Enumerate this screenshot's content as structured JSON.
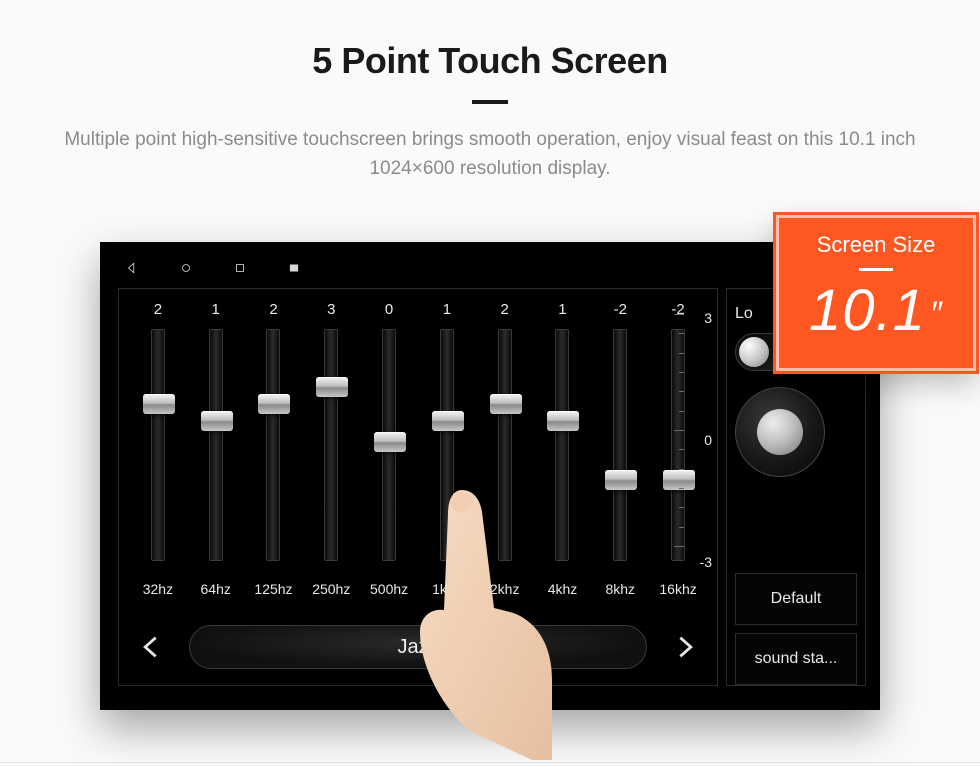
{
  "header": {
    "title": "5 Point Touch Screen",
    "subtitle": "Multiple point high-sensitive touchscreen brings smooth operation, enjoy visual feast on this 10.1 inch 1024×600 resolution display."
  },
  "callout": {
    "title": "Screen Size",
    "value": "10.1",
    "unit": "″"
  },
  "equalizer": {
    "bands": [
      {
        "freq": "32hz",
        "value": "2",
        "thumb_pct": 30
      },
      {
        "freq": "64hz",
        "value": "1",
        "thumb_pct": 38
      },
      {
        "freq": "125hz",
        "value": "2",
        "thumb_pct": 30
      },
      {
        "freq": "250hz",
        "value": "3",
        "thumb_pct": 22
      },
      {
        "freq": "500hz",
        "value": "0",
        "thumb_pct": 48
      },
      {
        "freq": "1khz",
        "value": "1",
        "thumb_pct": 38
      },
      {
        "freq": "2khz",
        "value": "2",
        "thumb_pct": 30
      },
      {
        "freq": "4khz",
        "value": "1",
        "thumb_pct": 38
      },
      {
        "freq": "8khz",
        "value": "-2",
        "thumb_pct": 66
      },
      {
        "freq": "16khz",
        "value": "-2",
        "thumb_pct": 66
      }
    ],
    "scale": {
      "top": "3",
      "mid": "0",
      "bottom": "-3"
    },
    "preset": "Jazz"
  },
  "side": {
    "loud_label": "Lo",
    "default_button": "Default",
    "sound_button": "sound sta..."
  }
}
